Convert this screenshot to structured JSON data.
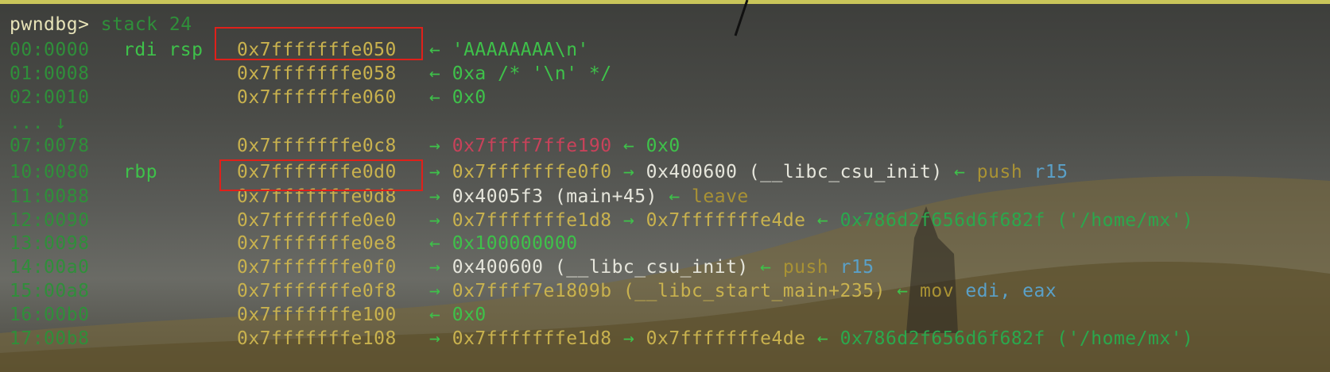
{
  "terminal": {
    "prompt": "pwndbg>",
    "command": "stack 24",
    "rows": [
      {
        "offset": "00:0000",
        "reg": "rdi rsp",
        "addr": "0x7fffffffe050",
        "a1": "←",
        "v1": "'AAAAAAAA\\n'",
        "a2": "",
        "v2": "",
        "a3": "",
        "v3": "",
        "a4": "",
        "v4": ""
      },
      {
        "offset": "01:0008",
        "reg": "",
        "addr": "0x7fffffffe058",
        "a1": "←",
        "v1": "0xa /* '\\n' */",
        "a2": "",
        "v2": "",
        "a3": "",
        "v3": "",
        "a4": "",
        "v4": ""
      },
      {
        "offset": "02:0010",
        "reg": "",
        "addr": "0x7fffffffe060",
        "a1": "←",
        "v1": "0x0",
        "a2": "",
        "v2": "",
        "a3": "",
        "v3": "",
        "a4": "",
        "v4": ""
      },
      {
        "offset": "... ↓",
        "reg": "",
        "addr": "",
        "a1": "",
        "v1": "",
        "a2": "",
        "v2": "",
        "a3": "",
        "v3": "",
        "a4": "",
        "v4": ""
      },
      {
        "offset": "07:0078",
        "reg": "",
        "addr": "0x7fffffffe0c8",
        "a1": "→",
        "v1": "0x7ffff7ffe190",
        "a2": "←",
        "v2": "0x0",
        "a3": "",
        "v3": "",
        "a4": "",
        "v4": ""
      },
      {
        "offset": "10:0080",
        "reg": "rbp",
        "addr": "0x7fffffffe0d0",
        "a1": "→",
        "v1": "0x7fffffffe0f0",
        "a2": "→",
        "v2": "0x400600 (__libc_csu_init)",
        "a3": "←",
        "v3": "push",
        "a4": "",
        "v4": "r15"
      },
      {
        "offset": "11:0088",
        "reg": "",
        "addr": "0x7fffffffe0d8",
        "a1": "→",
        "v1": "0x4005f3 (main+45)",
        "a2": "←",
        "v2": "leave",
        "a3": "",
        "v3": "",
        "a4": "",
        "v4": ""
      },
      {
        "offset": "12:0090",
        "reg": "",
        "addr": "0x7fffffffe0e0",
        "a1": "→",
        "v1": "0x7fffffffe1d8",
        "a2": "→",
        "v2": "0x7fffffffe4de",
        "a3": "←",
        "v3": "0x786d2f656d6f682f ('/home/mx')",
        "a4": "",
        "v4": ""
      },
      {
        "offset": "13:0098",
        "reg": "",
        "addr": "0x7fffffffe0e8",
        "a1": "←",
        "v1": "0x100000000",
        "a2": "",
        "v2": "",
        "a3": "",
        "v3": "",
        "a4": "",
        "v4": ""
      },
      {
        "offset": "14:00a0",
        "reg": "",
        "addr": "0x7fffffffe0f0",
        "a1": "→",
        "v1": "0x400600 (__libc_csu_init)",
        "a2": "←",
        "v2": "push",
        "a3": "",
        "v3": "r15",
        "a4": "",
        "v4": ""
      },
      {
        "offset": "15:00a8",
        "reg": "",
        "addr": "0x7fffffffe0f8",
        "a1": "→",
        "v1": "0x7ffff7e1809b (__libc_start_main+235)",
        "a2": "←",
        "v2": "mov",
        "a3": "",
        "v3": "edi, eax",
        "a4": "",
        "v4": ""
      },
      {
        "offset": "16:00b0",
        "reg": "",
        "addr": "0x7fffffffe100",
        "a1": "←",
        "v1": "0x0",
        "a2": "",
        "v2": "",
        "a3": "",
        "v3": "",
        "a4": "",
        "v4": ""
      },
      {
        "offset": "17:00b8",
        "reg": "",
        "addr": "0x7fffffffe108",
        "a1": "→",
        "v1": "0x7fffffffe1d8",
        "a2": "→",
        "v2": "0x7fffffffe4de",
        "a3": "←",
        "v3": "0x786d2f656d6f682f ('/home/mx')",
        "a4": "",
        "v4": ""
      }
    ]
  },
  "colors": {
    "highlight_box": "#e0201a",
    "address": "#c9b24e",
    "arrow": "#3ec24a",
    "prompt": "#e7e3b8",
    "top_bar": "#c9c55a"
  }
}
